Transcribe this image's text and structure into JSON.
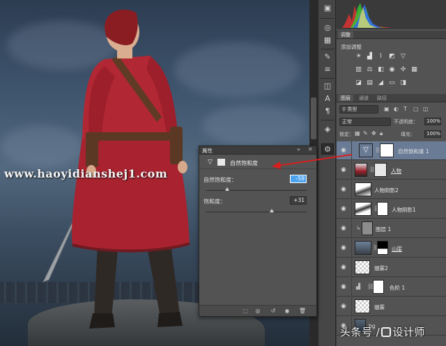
{
  "watermark": "www.haoyidianshej1.com",
  "toolstrip": {
    "icons": [
      "image-icon",
      "grid-icon",
      "brush-settings-icon",
      "styles-icon",
      "text-char-icon",
      "paragraph-icon",
      "3d-cube-icon",
      "adjust-icon"
    ]
  },
  "adjustments_panel": {
    "tabs": [
      "调整"
    ],
    "title": "添加调整"
  },
  "layers_panel": {
    "tabs": [
      "图层",
      "通道",
      "路径"
    ],
    "filter_label": "类型",
    "blend_mode": "正常",
    "opacity_label": "不透明度：",
    "opacity_value": "100%",
    "lock_label": "锁定：",
    "fill_label": "填充：",
    "fill_value": "100%",
    "layers": [
      {
        "name": "自然饱和度 1",
        "selected": true
      },
      {
        "name": "人物",
        "selected": false
      },
      {
        "name": "人物阴影2",
        "selected": false
      },
      {
        "name": "人物阴影1",
        "selected": false
      },
      {
        "name": "图层 1",
        "selected": false
      },
      {
        "name": "山崖",
        "selected": false
      },
      {
        "name": "烟雾2",
        "selected": false
      },
      {
        "name": "色阶 1",
        "selected": false
      },
      {
        "name": "烟雾",
        "selected": false
      },
      {
        "name": "bg",
        "selected": false
      }
    ]
  },
  "properties_panel": {
    "title": "属性",
    "adjustment_name": "自然饱和度",
    "vibrance": {
      "label": "自然饱和度：",
      "value": "-59",
      "level": -59
    },
    "saturation": {
      "label": "饱和度：",
      "value": "+31",
      "level": 31
    }
  },
  "brand": {
    "prefix": "头条号",
    "slash": "/",
    "name": "设计师"
  },
  "colors": {
    "selection": "#6a7b95",
    "active_field": "#4da3ee",
    "arrow": "#d61f1f"
  }
}
